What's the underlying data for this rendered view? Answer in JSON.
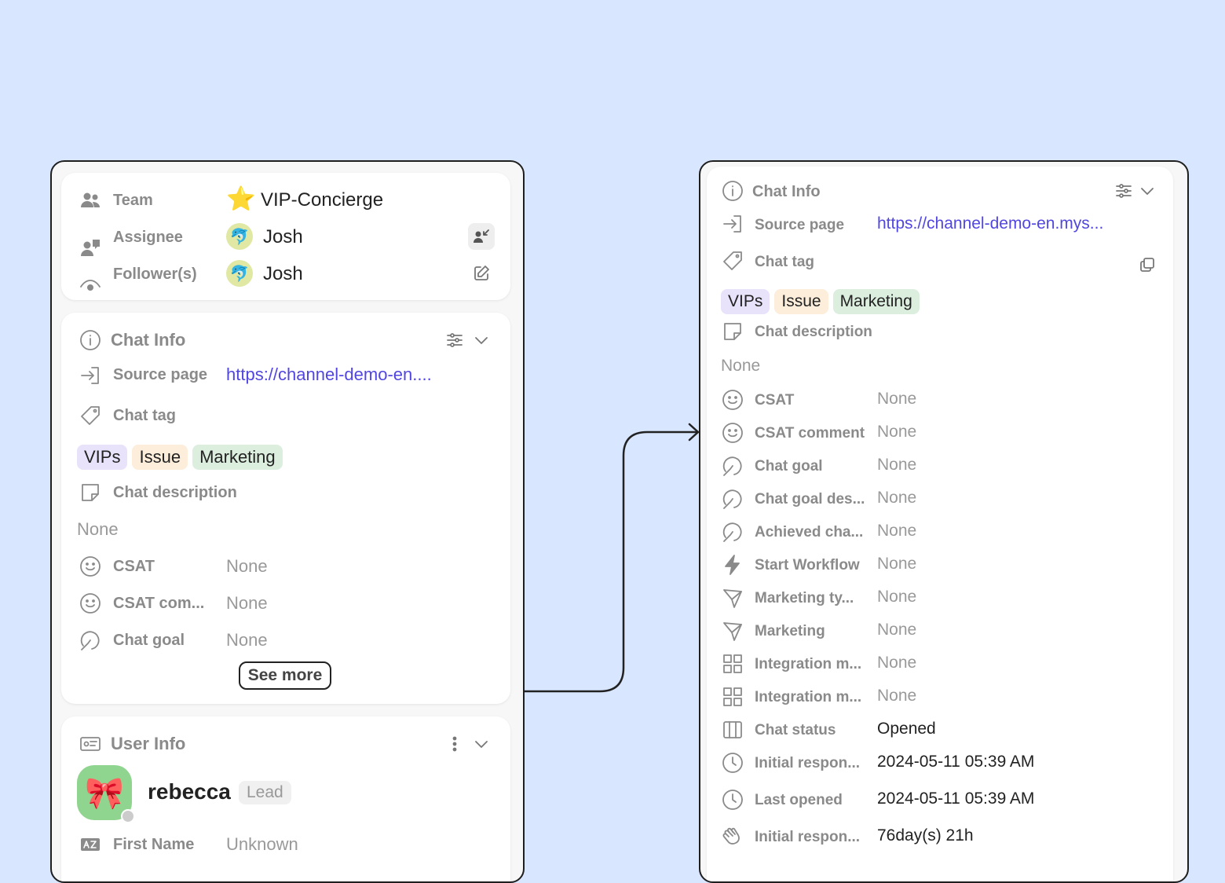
{
  "left": {
    "assignment": {
      "team_label": "Team",
      "team_value": "VIP-Concierge",
      "team_emoji": "⭐",
      "assignee_label": "Assignee",
      "assignee_name": "Josh",
      "follower_label": "Follower(s)",
      "follower_name": "Josh",
      "avatar_emoji": "🐬"
    },
    "chat_info": {
      "title": "Chat Info",
      "source_page_label": "Source page",
      "source_page_value": "https://channel-demo-en....",
      "chat_tag_label": "Chat tag",
      "tags": [
        "VIPs",
        "Issue",
        "Marketing"
      ],
      "chat_description_label": "Chat description",
      "chat_description_value": "None",
      "fields": [
        {
          "label": "CSAT",
          "value": "None",
          "icon": "smile-icon"
        },
        {
          "label": "CSAT com...",
          "value": "None",
          "icon": "smile-icon"
        },
        {
          "label": "Chat goal",
          "value": "None",
          "icon": "goal-icon"
        }
      ],
      "see_more": "See more"
    },
    "user_info": {
      "title": "User Info",
      "user_name": "rebecca",
      "user_badge": "Lead",
      "avatar_emoji": "🎀",
      "first_name_label": "First Name",
      "first_name_value": "Unknown"
    }
  },
  "right": {
    "chat_info": {
      "title": "Chat Info",
      "source_page_label": "Source page",
      "source_page_value": "https://channel-demo-en.mys...",
      "chat_tag_label": "Chat tag",
      "tags": [
        "VIPs",
        "Issue",
        "Marketing"
      ],
      "chat_description_label": "Chat description",
      "chat_description_value": "None",
      "fields": [
        {
          "label": "CSAT",
          "value": "None",
          "icon": "smile-icon"
        },
        {
          "label": "CSAT comment",
          "value": "None",
          "icon": "smile-icon"
        },
        {
          "label": "Chat goal",
          "value": "None",
          "icon": "goal-icon"
        },
        {
          "label": "Chat goal des...",
          "value": "None",
          "icon": "goal-icon"
        },
        {
          "label": "Achieved cha...",
          "value": "None",
          "icon": "goal-icon"
        },
        {
          "label": "Start Workflow",
          "value": "None",
          "icon": "lightning-icon"
        },
        {
          "label": "Marketing ty...",
          "value": "None",
          "icon": "send-icon"
        },
        {
          "label": "Marketing",
          "value": "None",
          "icon": "send-icon"
        },
        {
          "label": "Integration m...",
          "value": "None",
          "icon": "grid-icon"
        },
        {
          "label": "Integration m...",
          "value": "None",
          "icon": "grid-icon"
        },
        {
          "label": "Chat status",
          "value": "Opened",
          "icon": "columns-icon"
        },
        {
          "label": "Initial respon...",
          "value": "2024-05-11 05:39 AM",
          "icon": "clock-icon"
        },
        {
          "label": "Last opened",
          "value": "2024-05-11 05:39 AM",
          "icon": "clock-icon"
        },
        {
          "label": "Initial respon...",
          "value": "76day(s) 21h",
          "icon": "wave-icon"
        }
      ]
    }
  },
  "colors": {
    "background": "#d9e6ff",
    "link": "#5146e0",
    "tag_vips": "#e8e3fb",
    "tag_issue": "#fdeedb",
    "tag_marketing": "#dcefdf"
  }
}
